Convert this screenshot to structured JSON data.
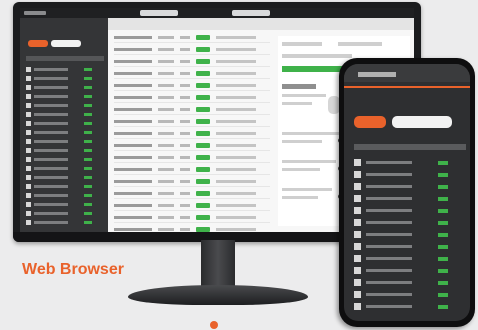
{
  "caption": "Web Browser",
  "colors": {
    "accent": "#e9622b",
    "status_ok": "#3fb24a",
    "device_dark": "#1b1c1e",
    "background": "#ececed"
  },
  "desktop": {
    "sidebar_rows": 18,
    "table_rows": 17
  },
  "phone": {
    "rows": 13
  }
}
